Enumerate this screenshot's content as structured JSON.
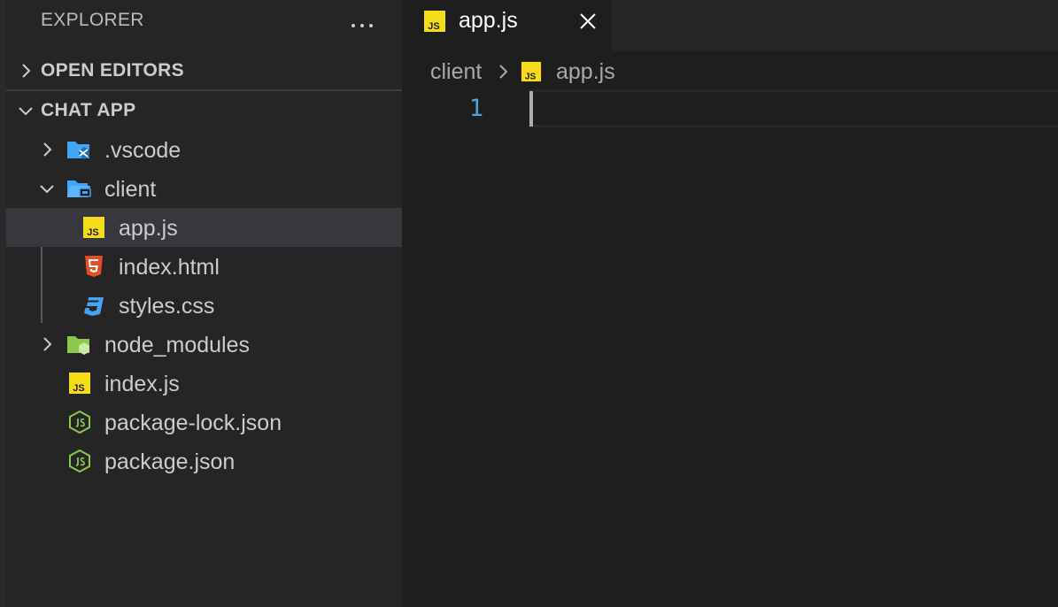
{
  "explorer": {
    "title": "EXPLORER",
    "more_icon": "ellipsis-icon",
    "sections": {
      "open_editors": {
        "label": "OPEN EDITORS",
        "expanded": false
      },
      "project": {
        "label": "CHAT APP",
        "expanded": true
      }
    },
    "tree": [
      {
        "name": ".vscode",
        "type": "folder",
        "expanded": false,
        "icon": "vscode-folder-icon"
      },
      {
        "name": "client",
        "type": "folder",
        "expanded": true,
        "icon": "client-folder-icon"
      },
      {
        "name": "app.js",
        "type": "file",
        "icon": "javascript-icon",
        "selected": true
      },
      {
        "name": "index.html",
        "type": "file",
        "icon": "html5-icon"
      },
      {
        "name": "styles.css",
        "type": "file",
        "icon": "css3-icon"
      },
      {
        "name": "node_modules",
        "type": "folder",
        "expanded": false,
        "icon": "node-folder-icon"
      },
      {
        "name": "index.js",
        "type": "file",
        "icon": "javascript-icon"
      },
      {
        "name": "package-lock.json",
        "type": "file",
        "icon": "nodejs-icon"
      },
      {
        "name": "package.json",
        "type": "file",
        "icon": "nodejs-icon"
      }
    ]
  },
  "editor": {
    "tabs": [
      {
        "label": "app.js",
        "icon": "javascript-icon",
        "active": true
      }
    ],
    "breadcrumb": {
      "folder": "client",
      "file": "app.js"
    },
    "lines": [
      "1"
    ]
  },
  "colors": {
    "js_badge": "#f5de19",
    "html": "#e44d26",
    "css": "#42a5f5",
    "folder_blue": "#42a5f5",
    "node_green": "#8cc84b",
    "line_number": "#4fa1d8",
    "selected_row": "#37373d"
  }
}
